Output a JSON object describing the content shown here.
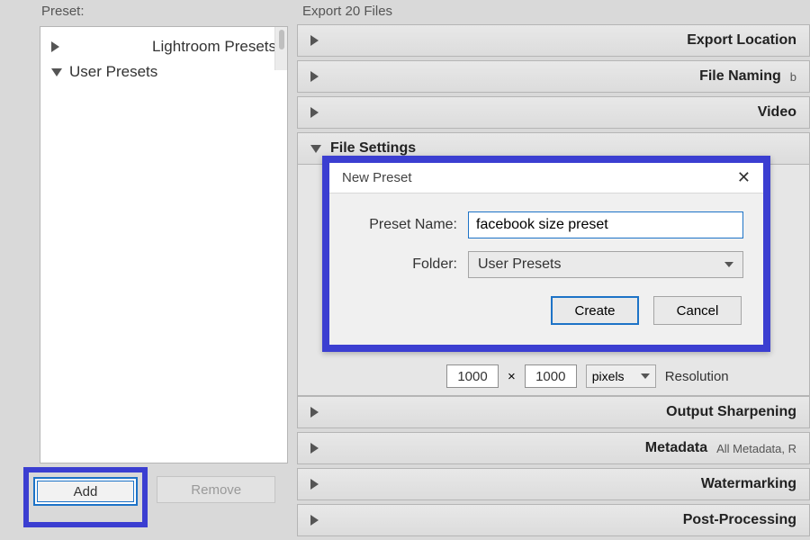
{
  "left": {
    "header": "Preset:",
    "presets": {
      "lightroom": "Lightroom Presets",
      "user": "User Presets"
    },
    "add_label": "Add",
    "remove_label": "Remove"
  },
  "right": {
    "header": "Export 20 Files",
    "sections": {
      "export_location": "Export Location",
      "file_naming": "File Naming",
      "file_naming_status": "b",
      "video": "Video",
      "file_settings": "File Settings",
      "output_sharpening": "Output Sharpening",
      "metadata": "Metadata",
      "metadata_status": "All Metadata, R",
      "watermarking": "Watermarking",
      "post_processing": "Post-Processing"
    },
    "dimensions": {
      "width": "1000",
      "sep": "×",
      "height": "1000",
      "unit": "pixels",
      "resolution_label": "Resolution"
    }
  },
  "dialog": {
    "title": "New Preset",
    "name_label": "Preset Name:",
    "name_value": "facebook size preset",
    "folder_label": "Folder:",
    "folder_value": "User Presets",
    "create": "Create",
    "cancel": "Cancel"
  }
}
